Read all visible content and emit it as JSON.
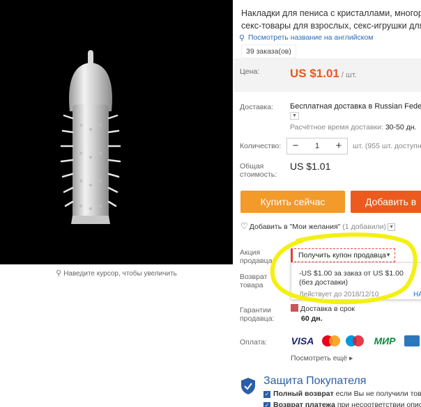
{
  "product": {
    "title_line1": "Накладки для пениса с кристаллами, многор",
    "title_line2": "секс-товары для взрослых, секс-игрушки для",
    "translate_link": "Посмотреть название на английском",
    "orders": "39 заказа(ов)"
  },
  "image": {
    "zoom_hint": "Наведите курсор, чтобы увеличить"
  },
  "price": {
    "label": "Цена:",
    "value": "US $1.01",
    "unit": "/ шт."
  },
  "shipping": {
    "label": "Доставка:",
    "method": "Бесплатная доставка в Russian Feder",
    "time_label": "Расчётное время доставки:",
    "time_value": "30-50 дн."
  },
  "quantity": {
    "label": "Количество:",
    "value": "1",
    "minus": "−",
    "plus": "+",
    "available": "шт. (955 шт. доступн"
  },
  "total": {
    "label_line1": "Общая",
    "label_line2": "стоимость:",
    "value": "US $1.01"
  },
  "buttons": {
    "buy_now": "Купить сейчас",
    "add_to_cart": "Добавить в"
  },
  "wishlist": {
    "label": "Добавить в \"Мои желания\"",
    "count": "(1 добавили)"
  },
  "seller_promo": {
    "label_line1": "Акция",
    "label_line2": "продавца:",
    "coupon_button": "Получить купон продавца",
    "coupon_line1": "-US $1.00 за заказ от US $1.00",
    "coupon_line2": "(без доставки)",
    "valid_until": "Действует до 2018/12/10",
    "more": "НА"
  },
  "returns": {
    "label_line1": "Возврат",
    "label_line2": "товара"
  },
  "guarantee": {
    "label_line1": "Гарантии",
    "label_line2": "продавца:",
    "delivery": "Доставка в срок",
    "days": "60 дн."
  },
  "payment": {
    "label": "Оплата:",
    "logos": [
      "VISA",
      "MasterCard",
      "Maestro",
      "МИР",
      "AMEX"
    ],
    "see_more": "Посмотреть ещё"
  },
  "protection": {
    "title": "Защита Покупателя",
    "item1_bold": "Полный возврат",
    "item1_rest": "если Вы не получили това",
    "item2_bold": "Возврат платежа",
    "item2_rest": "при несоответствии описа"
  },
  "colors": {
    "price": "#e8591a",
    "buy_now": "#f29a2a",
    "add_to_cart": "#ec5b1d",
    "link": "#2a6bb3",
    "highlight": "#f4f010"
  },
  "icons": [
    "magnifier-icon",
    "translate-icon",
    "heart-icon",
    "chevron-down-icon",
    "shield-icon",
    "check-icon"
  ]
}
